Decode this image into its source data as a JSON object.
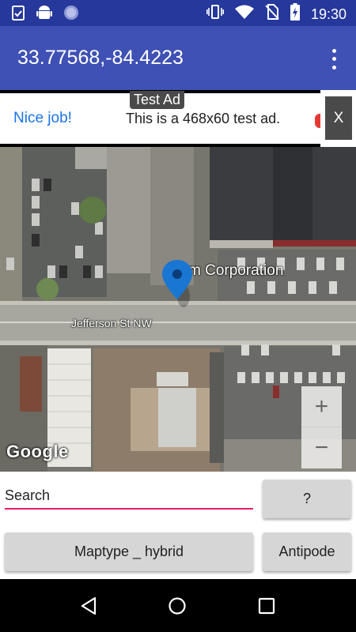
{
  "status_bar": {
    "time": "19:30",
    "left_icons": [
      "clipboard-check-icon",
      "android-icon",
      "circle-dots-icon"
    ],
    "right_icons": [
      "vibrate-icon",
      "wifi-icon",
      "no-sim-icon",
      "battery-charging-icon"
    ]
  },
  "app_bar": {
    "title": "33.77568,-84.4223",
    "menu_icon": "overflow-menu-icon",
    "color": "#3f51b5"
  },
  "ad": {
    "label": "Test Ad",
    "nice_job": "Nice job!",
    "text": "This is a 468x60 test ad.",
    "close": "X"
  },
  "map": {
    "place_label": "m Corporation",
    "street_label": "Jefferson St NW",
    "logo": "Google",
    "zoom_in": "+",
    "zoom_out": "−",
    "marker_icon": "map-pin-icon"
  },
  "controls": {
    "search_placeholder": "Search",
    "question_button": "?",
    "maptype_button": "Maptype _ hybrid",
    "antipode_button": "Antipode",
    "accent": "#e91e63"
  },
  "nav_bar": {
    "back_icon": "back-triangle-icon",
    "home_icon": "home-circle-icon",
    "recents_icon": "recents-square-icon"
  }
}
